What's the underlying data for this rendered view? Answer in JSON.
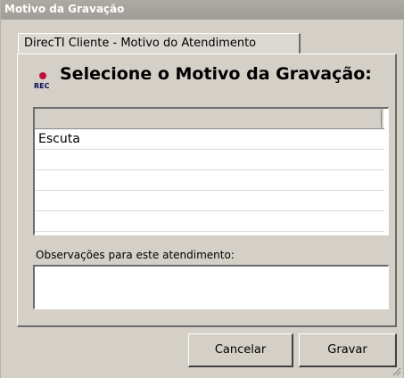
{
  "window": {
    "title": "Motivo da Gravação"
  },
  "tab": {
    "label": "DirecTI Cliente - Motivo do Atendimento"
  },
  "rec_icon": {
    "label": "REC",
    "color": "#c0103a"
  },
  "heading": "Selecione o Motivo da Gravação:",
  "list": {
    "header": "",
    "items": [
      "Escuta",
      "",
      "",
      "",
      ""
    ]
  },
  "observations": {
    "label": "Observações para este atendimento:",
    "value": ""
  },
  "buttons": {
    "cancel": "Cancelar",
    "save": "Gravar"
  }
}
